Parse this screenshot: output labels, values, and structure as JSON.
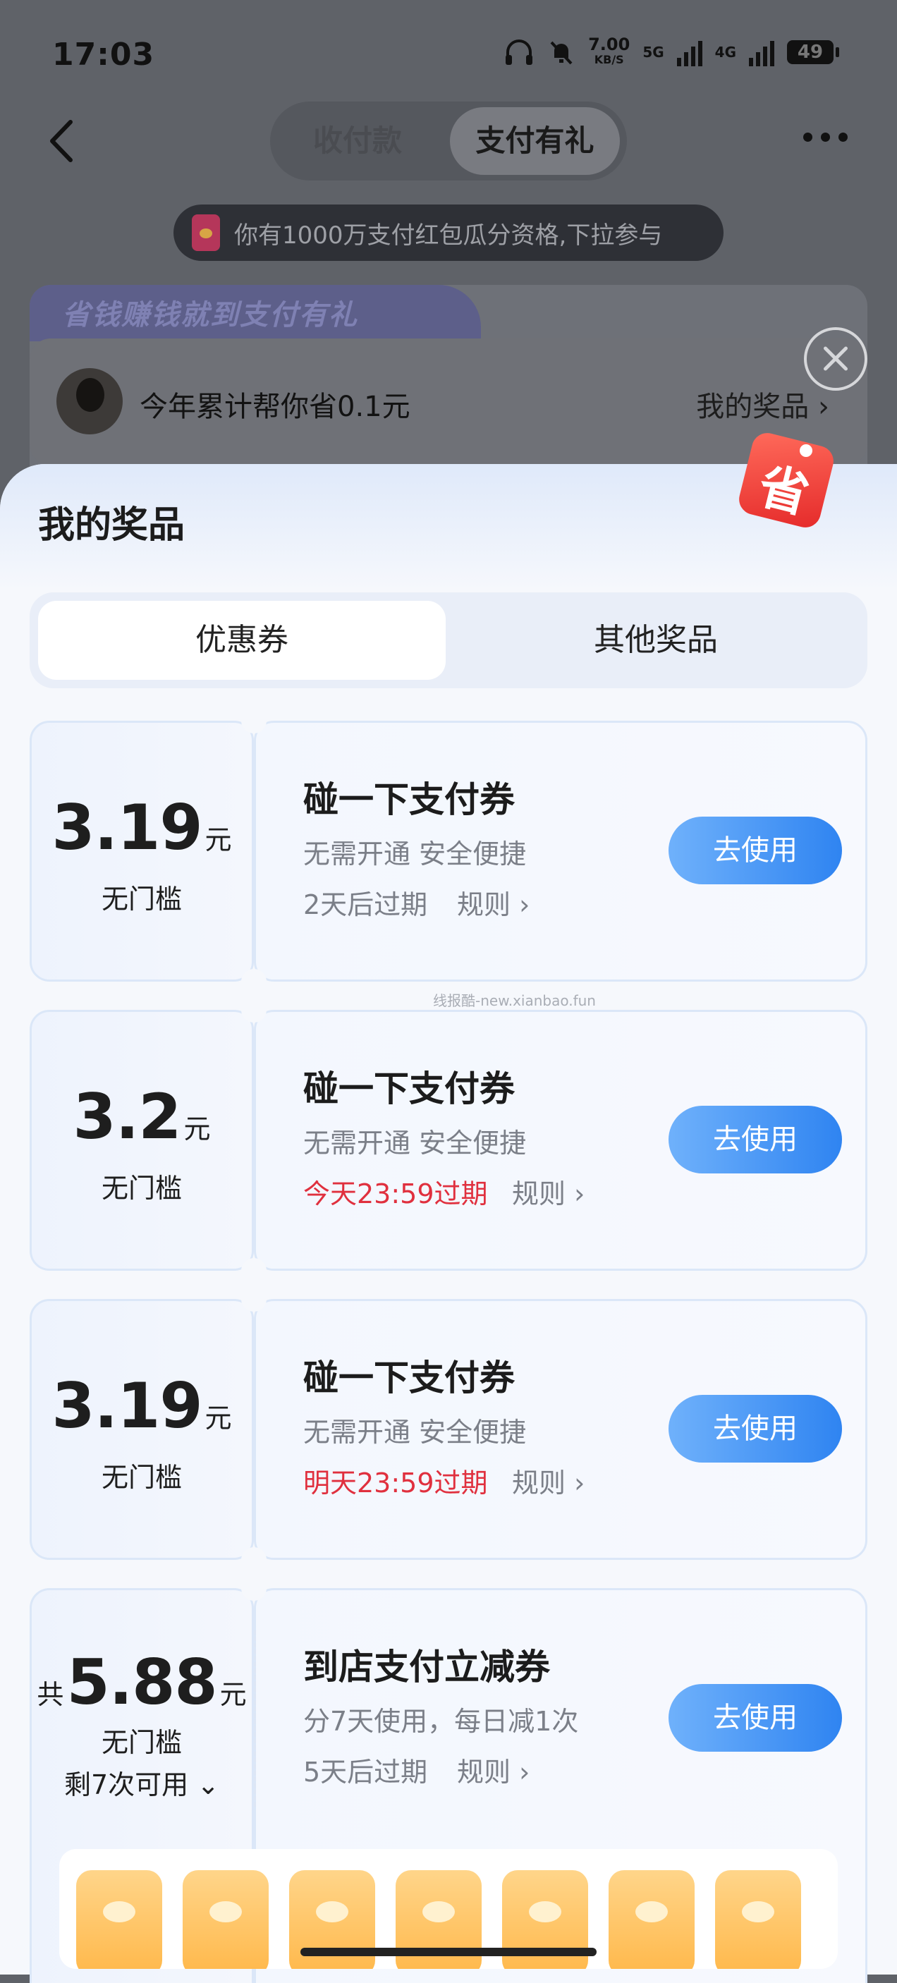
{
  "status": {
    "time": "17:03",
    "net_speed_value": "7.00",
    "net_speed_unit": "KB/S",
    "signal1": "5G",
    "signal2": "4G",
    "battery": "49"
  },
  "header": {
    "tabs": [
      "收付款",
      "支付有礼"
    ],
    "active_tab": "支付有礼"
  },
  "notice": {
    "text": "你有1000万支付红包瓜分资格,下拉参与"
  },
  "banner": {
    "slogan": "省钱赚钱就到支付有礼",
    "summary": "今年累计帮你省0.1元",
    "my_prizes_link": "我的奖品 ›"
  },
  "sheet": {
    "title": "我的奖品",
    "badge_char": "省",
    "tabs": [
      "优惠券",
      "其他奖品"
    ]
  },
  "coupons": [
    {
      "prefix": "",
      "amount": "3.19",
      "unit": "元",
      "threshold": "无门槛",
      "remain": "",
      "title": "碰一下支付券",
      "desc": "无需开通 安全便捷",
      "expire": "2天后过期",
      "expire_urgent": false,
      "rules": "规则 ›",
      "button": "去使用"
    },
    {
      "prefix": "",
      "amount": "3.2",
      "unit": "元",
      "threshold": "无门槛",
      "remain": "",
      "title": "碰一下支付券",
      "desc": "无需开通 安全便捷",
      "expire": "今天23:59过期",
      "expire_urgent": true,
      "rules": "规则 ›",
      "button": "去使用"
    },
    {
      "prefix": "",
      "amount": "3.19",
      "unit": "元",
      "threshold": "无门槛",
      "remain": "",
      "title": "碰一下支付券",
      "desc": "无需开通 安全便捷",
      "expire": "明天23:59过期",
      "expire_urgent": true,
      "rules": "规则 ›",
      "button": "去使用"
    },
    {
      "prefix": "共",
      "amount": "5.88",
      "unit": "元",
      "threshold": "无门槛",
      "remain": "剩7次可用 ⌄",
      "title": "到店支付立减券",
      "desc": "分7天使用，每日减1次",
      "expire": "5天后过期",
      "expire_urgent": false,
      "rules": "规则 ›",
      "button": "去使用"
    }
  ],
  "watermark": "线报酷-new.xianbao.fun",
  "colors": {
    "accent_blue": "#2f84f1",
    "urgent_red": "#e0303e"
  }
}
